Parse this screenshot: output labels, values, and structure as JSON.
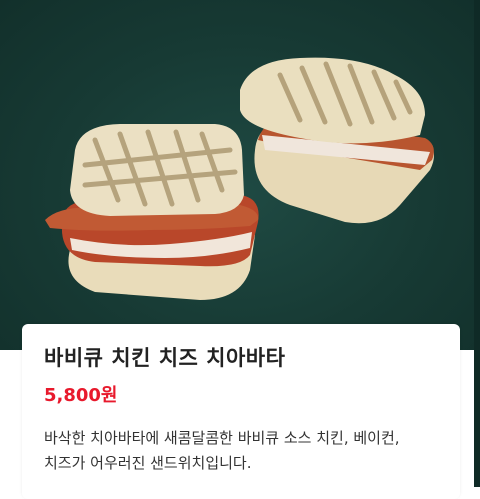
{
  "product": {
    "name": "바비큐 치킨 치즈 치아바타",
    "price": "5,800원",
    "description_line1": "바삭한 치아바타에 새콤달콤한 바비큐 소스 치킨, 베이컨,",
    "description_line2": "치즈가 어우러진 샌드위치입니다.",
    "image_subject": "sandwich-photo"
  },
  "colors": {
    "background_green": "#173a34",
    "price_red": "#e8192c"
  }
}
